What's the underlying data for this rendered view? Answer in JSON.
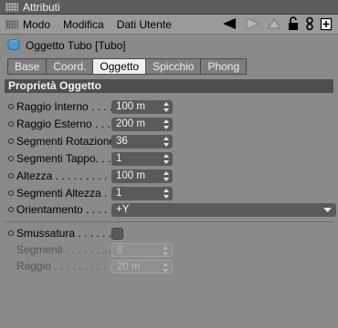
{
  "window": {
    "title": "Attributi"
  },
  "menu": {
    "items": [
      "Modo",
      "Modifica",
      "Dati Utente"
    ]
  },
  "object": {
    "name": "Oggetto Tubo [Tubo]"
  },
  "tabs": [
    "Base",
    "Coord.",
    "Oggetto",
    "Spicchio",
    "Phong"
  ],
  "active_tab": "Oggetto",
  "section": {
    "title": "Proprietà Oggetto"
  },
  "properties": [
    {
      "label": "Raggio Interno . . . .",
      "value": "100 m"
    },
    {
      "label": "Raggio Esterno . . .",
      "value": "200 m"
    },
    {
      "label": "Segmenti Rotazione",
      "value": "36"
    },
    {
      "label": "Segmenti Tappo. . .",
      "value": "1"
    },
    {
      "label": "Altezza . . . . . . . . .",
      "value": "100 m"
    },
    {
      "label": "Segmenti Altezza . .",
      "value": "1"
    }
  ],
  "orientation": {
    "label": "Orientamento . . . . .",
    "value": "+Y"
  },
  "fillet": {
    "label": "Smussatura . . . . . .",
    "checked": false,
    "segments": {
      "label": "Segmenti . . . . . . . .",
      "value": "8"
    },
    "radius": {
      "label": "Raggio . . . . . . . . .",
      "value": "20 m"
    }
  },
  "colors": {
    "field_bg": "#5a5a5a",
    "section_bg": "#4e4e4e",
    "panel_bg": "#8a8a8a",
    "active_tab_bg": "#f0f0f0"
  }
}
